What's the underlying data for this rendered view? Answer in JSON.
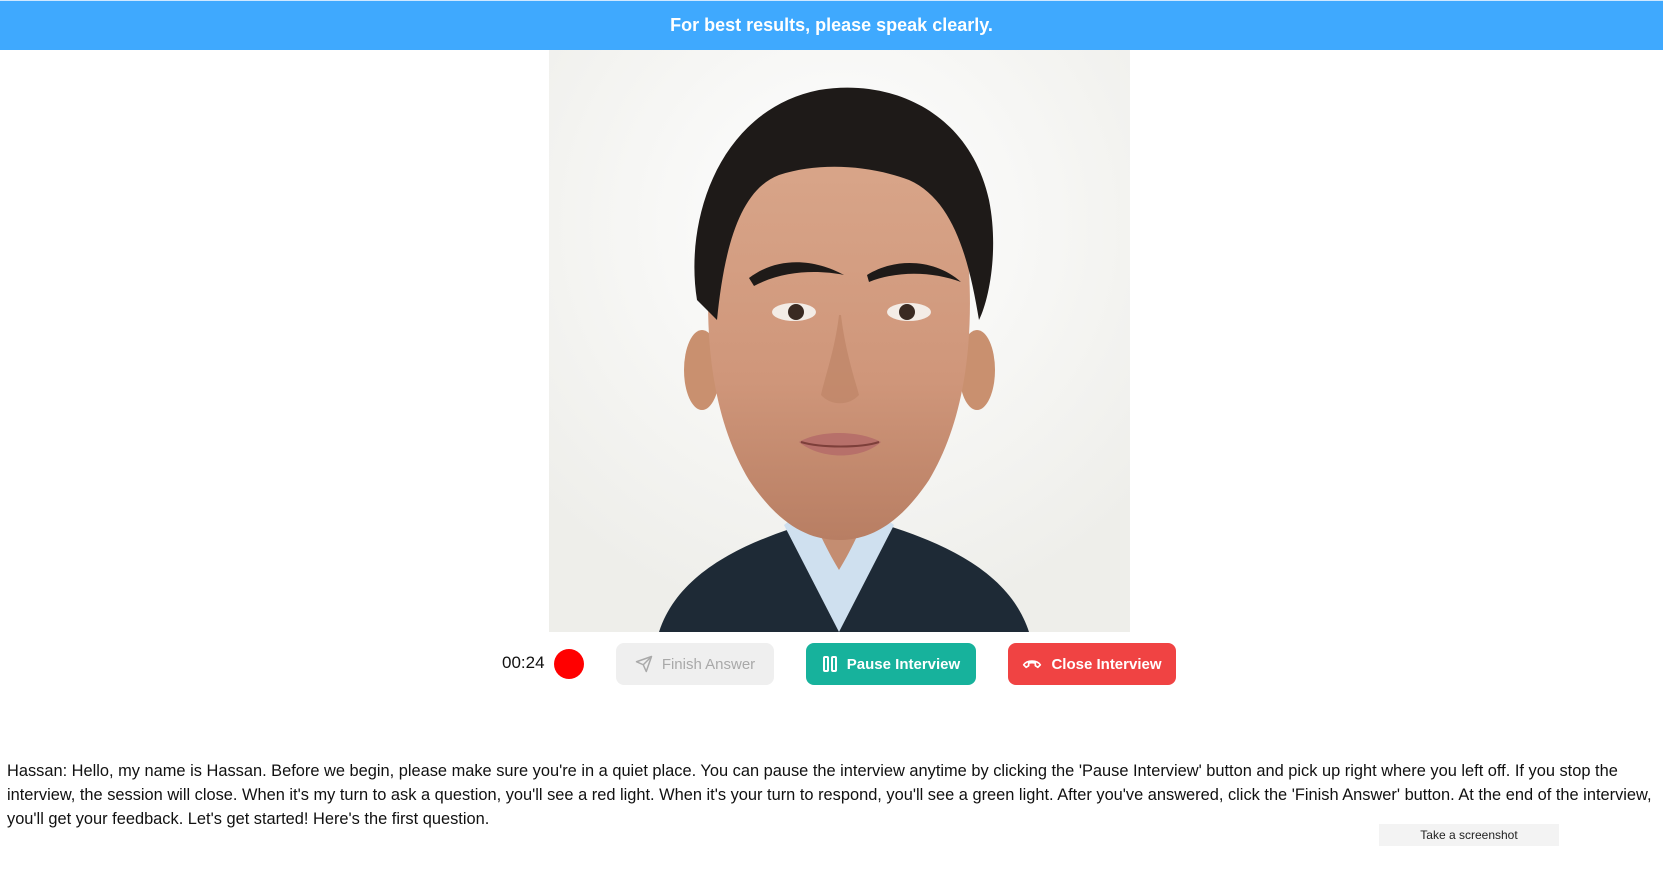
{
  "banner": {
    "text": "For best results, please speak clearly."
  },
  "interviewer": {
    "avatar_icon": "interviewer-portrait"
  },
  "controls": {
    "timer": "00:24",
    "recording_indicator_color": "#ff0000",
    "finish_answer": {
      "label": "Finish Answer",
      "icon": "send-icon",
      "enabled": false
    },
    "pause_interview": {
      "label": "Pause Interview",
      "icon": "pause-icon"
    },
    "close_interview": {
      "label": "Close Interview",
      "icon": "hang-up-phone-icon"
    }
  },
  "transcript": {
    "text": "Hassan: Hello, my name is Hassan. Before we begin, please make sure you're in a quiet place. You can pause the interview anytime by clicking the 'Pause Interview' button and pick up right where you left off. If you stop the interview, the session will close. When it's my turn to ask a question, you'll see a red light. When it's your turn to respond, you'll see a green light. After you've answered, click the 'Finish Answer' button. At the end of the interview, you'll get your feedback. Let's get started! Here's the first question."
  },
  "tooltip": {
    "text": "Take a screenshot"
  },
  "colors": {
    "banner": "#3fa9fe",
    "pause_button": "#17b29c",
    "close_button": "#f04343",
    "finish_button_disabled": "#efefef"
  }
}
